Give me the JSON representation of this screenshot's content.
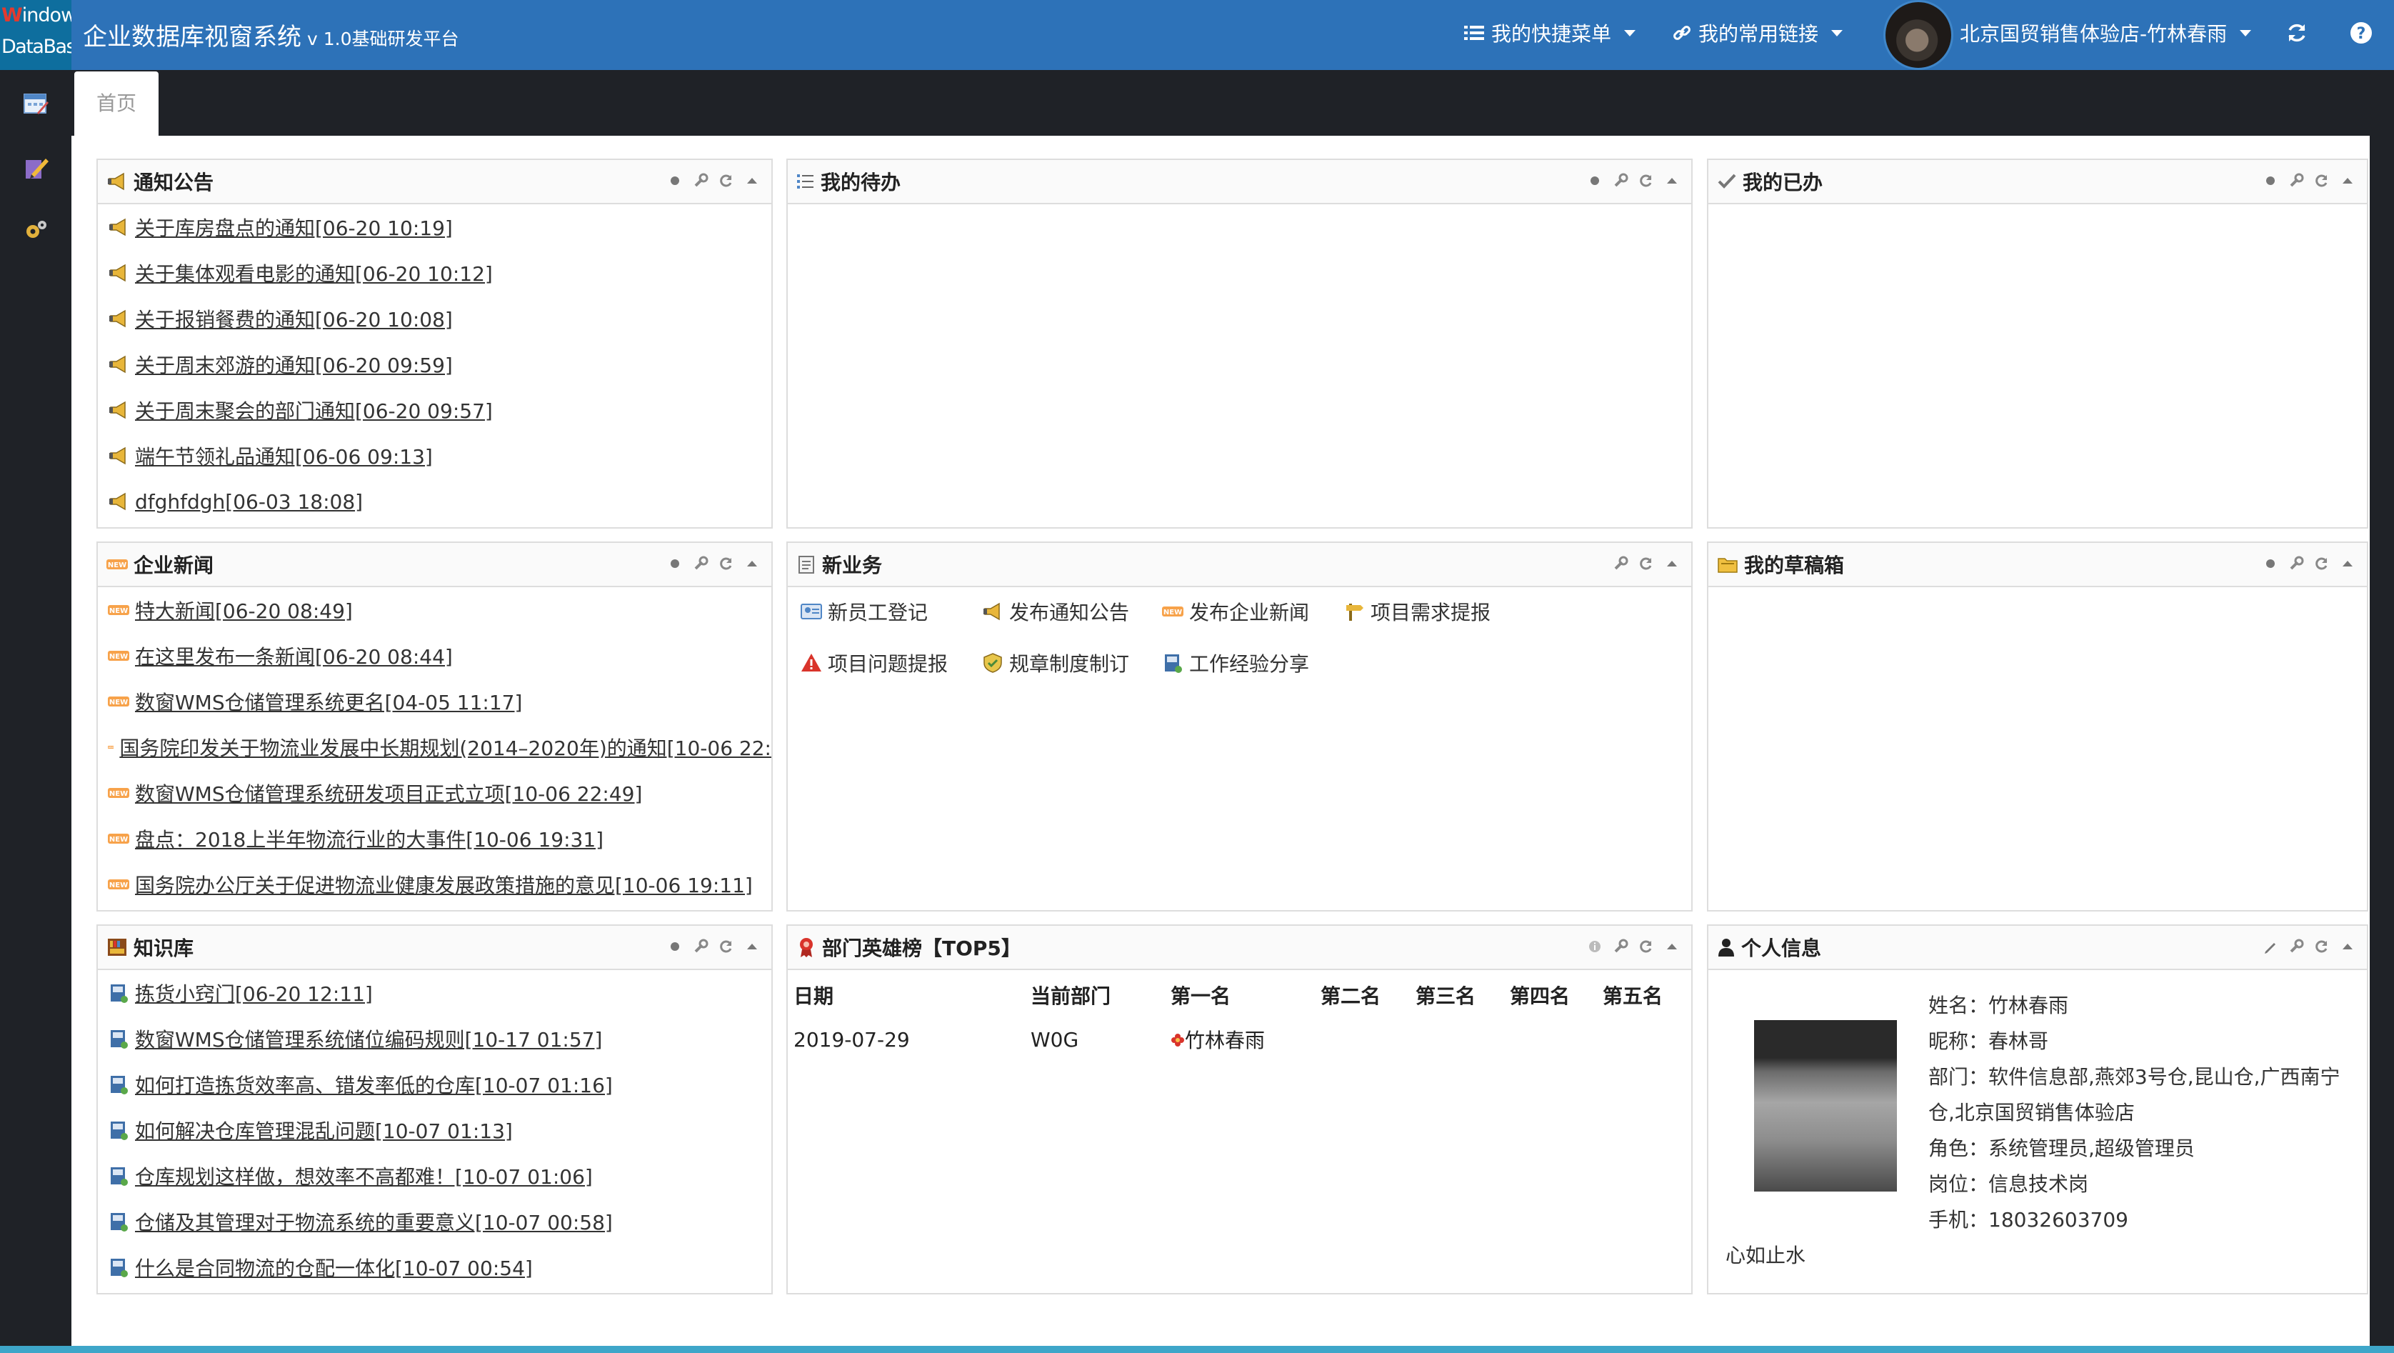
{
  "header": {
    "logo_line1_accent": "W",
    "logo_line1_rest": "indow",
    "logo_line2": "DataBase",
    "title": "企业数据库视窗系统",
    "version": "v 1.0基础研发平台",
    "quick_menu": "我的快捷菜单",
    "common_links": "我的常用链接",
    "user": "北京国贸销售体验店-竹林春雨"
  },
  "tabs": {
    "home": "首页"
  },
  "notice": {
    "title": "通知公告",
    "items": [
      "关于库房盘点的通知[06-20 10:19]",
      "关于集体观看电影的通知[06-20 10:12]",
      "关于报销餐费的通知[06-20 10:08]",
      "关于周末郊游的通知[06-20 09:59]",
      "关于周末聚会的部门通知[06-20 09:57]",
      "端午节领礼品通知[06-06 09:13]",
      "dfghfdgh[06-03 18:08]"
    ]
  },
  "todo": {
    "title": "我的待办"
  },
  "done": {
    "title": "我的已办"
  },
  "news": {
    "title": "企业新闻",
    "items": [
      "特大新闻[06-20 08:49]",
      "在这里发布一条新闻[06-20 08:44]",
      "数窗WMS仓储管理系统更名[04-05 11:17]",
      "国务院印发关于物流业发展中长期规划(2014–2020年)的通知[10-06 22:",
      "数窗WMS仓储管理系统研发项目正式立项[10-06 22:49]",
      "盘点：2018上半年物流行业的大事件[10-06 19:31]",
      "国务院办公厅关于促进物流业健康发展政策措施的意见[10-06 19:11]"
    ]
  },
  "new_business": {
    "title": "新业务",
    "items": [
      "新员工登记",
      "发布通知公告",
      "发布企业新闻",
      "项目需求提报",
      "项目问题提报",
      "规章制度制订",
      "工作经验分享"
    ]
  },
  "drafts": {
    "title": "我的草稿箱"
  },
  "knowledge": {
    "title": "知识库",
    "items": [
      "拣货小窍门[06-20 12:11]",
      "数窗WMS仓储管理系统储位编码规则[10-17 01:57]",
      "如何打造拣货效率高、错发率低的仓库[10-07 01:16]",
      "如何解决仓库管理混乱问题[10-07 01:13]",
      "仓库规划这样做，想效率不高都难！[10-07 01:06]",
      "仓储及其管理对于物流系统的重要意义[10-07 00:58]",
      "什么是合同物流的仓配一体化[10-07 00:54]"
    ]
  },
  "heroes": {
    "title": "部门英雄榜【TOP5】",
    "columns": [
      "日期",
      "当前部门",
      "第一名",
      "第二名",
      "第三名",
      "第四名",
      "第五名"
    ],
    "rows": [
      [
        "2019-07-29",
        "W0G",
        "竹林春雨",
        "",
        "",
        "",
        ""
      ]
    ]
  },
  "profile": {
    "title": "个人信息",
    "name": "姓名：竹林春雨",
    "nickname": "昵称：春林哥",
    "dept_line1": "部门：软件信息部,燕郊3号仓,昆山仓,广西南宁",
    "dept_line2": "仓,北京国贸销售体验店",
    "role": "角色：系统管理员,超级管理员",
    "post": "岗位：信息技术岗",
    "phone": "手机：18032603709",
    "motto": "心如止水"
  },
  "colors": {
    "header": "#2d72b8",
    "sidebar": "#1f2227",
    "logo_bg": "#0e6e9e"
  }
}
